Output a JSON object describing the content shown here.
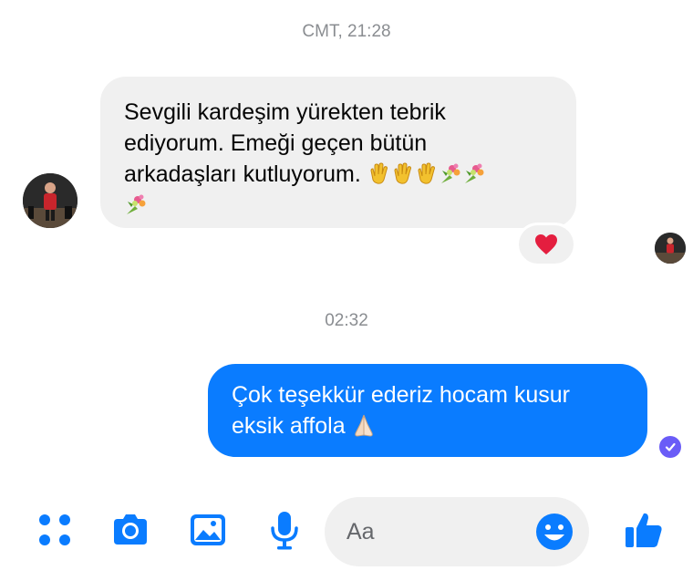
{
  "conversation": {
    "timestamps": [
      "CMT, 21:28",
      "02:32"
    ],
    "incoming_message": {
      "line1": "Sevgili kardeşim yürekten tebrik",
      "line2": "ediyorum. Emeği geçen bütün",
      "line3": "arkadaşları kutluyorum.",
      "emoji": [
        "clapping-hands",
        "clapping-hands",
        "clapping-hands",
        "bouquet",
        "bouquet",
        "bouquet"
      ],
      "reaction": "red-heart"
    },
    "outgoing_message": {
      "line1": "Çok teşekkür ederiz hocam kusur",
      "line2": "eksik affola",
      "emoji": [
        "folded-hands"
      ],
      "status": "seen"
    }
  },
  "composer": {
    "placeholder": "Aa",
    "icons": [
      "apps-icon",
      "camera-icon",
      "gallery-icon",
      "microphone-icon",
      "emoji-icon",
      "thumbs-up-icon"
    ]
  },
  "colors": {
    "accent": "#0A7CFF",
    "incoming_bubble": "#F0F0F0",
    "timestamp": "#8A8D91",
    "read_receipt": "#6A5CF7",
    "heart": "#E41E3F"
  }
}
